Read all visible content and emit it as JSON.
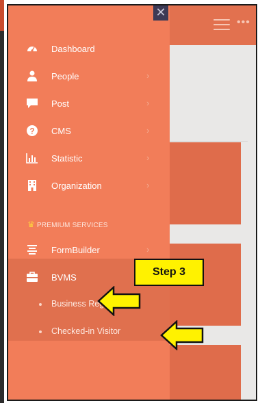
{
  "drawer": {
    "close_icon": "✕",
    "items": [
      {
        "label": "Dashboard",
        "icon": "dashboard-gauge-icon"
      },
      {
        "label": "People",
        "icon": "person-icon",
        "chevron": "›"
      },
      {
        "label": "Post",
        "icon": "comment-icon",
        "chevron": "›"
      },
      {
        "label": "CMS",
        "icon": "question-circle-icon",
        "chevron": "›"
      },
      {
        "label": "Statistic",
        "icon": "bar-chart-icon",
        "chevron": "›"
      },
      {
        "label": "Organization",
        "icon": "building-icon",
        "chevron": "›"
      }
    ],
    "premium_heading": "PREMIUM SERVICES",
    "premium_items": [
      {
        "label": "FormBuilder",
        "icon": "form-lines-icon",
        "chevron": "›"
      },
      {
        "label": "BVMS",
        "icon": "briefcase-icon"
      }
    ],
    "bvms_sub_items": [
      {
        "label": "Business Registrations"
      },
      {
        "label": "Checked-in Visitor"
      }
    ]
  },
  "annotation": {
    "step_label": "Step 3"
  },
  "colors": {
    "drawer_bg": "#f27d59",
    "header_bg": "#e2714f",
    "bvms_bg": "#e0704e",
    "highlight": "#fff200"
  }
}
